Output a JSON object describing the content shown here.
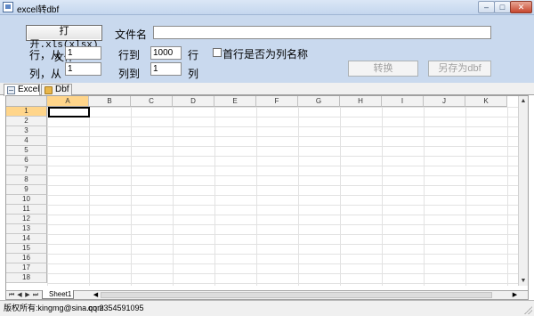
{
  "window": {
    "title": "excel转dbf",
    "min_symbol": "–",
    "max_symbol": "□",
    "close_symbol": "✕"
  },
  "form": {
    "open_button_label": "打开.xls(xlsx)文件",
    "filename_label": "文件名",
    "filename_value": "",
    "row_label": "行，从",
    "row_from": "1",
    "row_to_label": "行到",
    "row_to": "1000",
    "row_unit": "行",
    "header_checkbox_label": "首行是否为列名称",
    "header_checked": false,
    "col_label": "列，从",
    "col_from": "1",
    "col_to_label": "列到",
    "col_to": "1",
    "col_unit": "列",
    "convert_button": "转换",
    "saveas_button": "另存为dbf"
  },
  "tabs": [
    {
      "label": "Excel",
      "icon": "sheet-icon",
      "active": true
    },
    {
      "label": "Dbf",
      "icon": "database-icon",
      "active": false
    }
  ],
  "spreadsheet": {
    "columns": [
      "A",
      "B",
      "C",
      "D",
      "E",
      "F",
      "G",
      "H",
      "I",
      "J",
      "K"
    ],
    "rows": [
      "1",
      "2",
      "3",
      "4",
      "5",
      "6",
      "7",
      "8",
      "9",
      "10",
      "11",
      "12",
      "13",
      "14",
      "15",
      "16",
      "17",
      "18"
    ],
    "active_cell": "A1",
    "sheet_tab": "Sheet1",
    "nav": [
      "⏮",
      "◀",
      "▶",
      "⏭"
    ],
    "scroll_left": "◀",
    "scroll_right": "▶",
    "scroll_up": "▲",
    "scroll_down": "▼"
  },
  "status": {
    "copyright": "版权所有:kingmg@sina.com",
    "qq": "qq:2354591095"
  }
}
